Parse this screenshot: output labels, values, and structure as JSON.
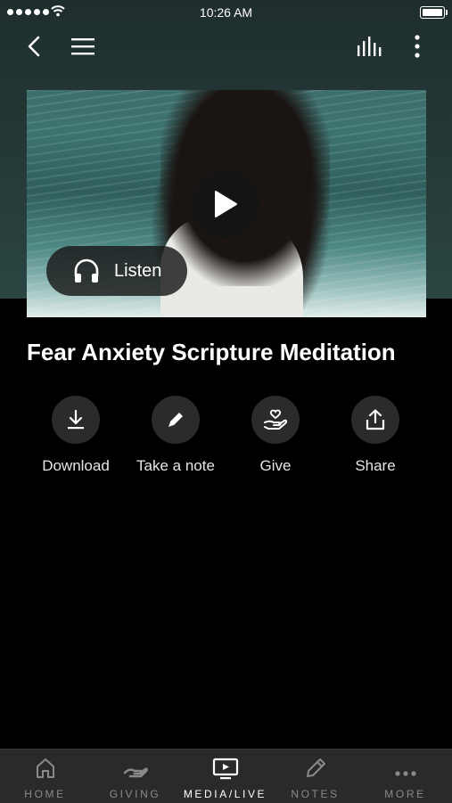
{
  "status_bar": {
    "time": "10:26 AM"
  },
  "media": {
    "listen_label": "Listen"
  },
  "title": "Fear Anxiety Scripture Meditation",
  "actions": [
    {
      "label": "Download",
      "icon": "download-icon"
    },
    {
      "label": "Take a note",
      "icon": "pencil-icon"
    },
    {
      "label": "Give",
      "icon": "heart-hand-icon"
    },
    {
      "label": "Share",
      "icon": "share-icon"
    }
  ],
  "tabs": [
    {
      "label": "HOME",
      "icon": "home-icon",
      "active": false
    },
    {
      "label": "GIVING",
      "icon": "giving-hand-icon",
      "active": false
    },
    {
      "label": "MEDIA/LIVE",
      "icon": "tv-play-icon",
      "active": true
    },
    {
      "label": "NOTES",
      "icon": "pencil-icon",
      "active": false
    },
    {
      "label": "MORE",
      "icon": "more-dots-icon",
      "active": false
    }
  ],
  "colors": {
    "background": "#000000",
    "header": "#243a38",
    "tabbar": "#2a2a2a",
    "inactive_tab": "#8a8a8a"
  }
}
